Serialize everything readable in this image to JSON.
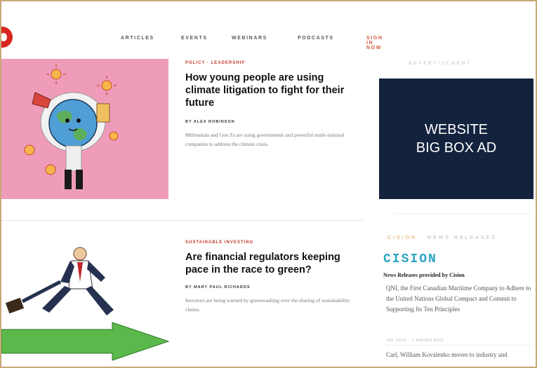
{
  "nav": {
    "items": [
      "ARTICLES",
      "EVENTS",
      "WEBINARS",
      "PODCASTS",
      "SIGN IN NOW"
    ]
  },
  "articles": [
    {
      "kicker": "POLICY · LEADERSHIP",
      "title": "How young people are using climate litigation to fight for their future",
      "byline": "BY ALEX ROBINSON",
      "summary": "Millennials and Gen Zs are suing governments and powerful multi-national companies to address the climate crisis."
    },
    {
      "kicker": "SUSTAINABLE INVESTING",
      "title": "Are financial regulators keeping pace in the race to green?",
      "byline": "BY MARY PAUL RICHARDS",
      "summary": "Investors are being warned by greenwashing over the sharing of sustainability claims."
    }
  ],
  "sidebar": {
    "advertisement_label": "ADVERTISEMENT",
    "ad": {
      "line1": "WEBSITE",
      "line2": "BIG BOX AD"
    },
    "newswire": {
      "label_prefix": "CISION",
      "label_suffix": "NEWS RELEASES",
      "logo": "CISION",
      "provided_by": "News Releases provided by Cision",
      "release1": "QNI, the First Canadian Maritime Company to Adhere to the United Nations Global Compact and Commit to Supporting Its Ten Principles",
      "release1_date": "JUL 2022 · 7 hours ago",
      "release2": "Carl, William Kovalenko moves to industry and "
    }
  },
  "colors": {
    "ad_background": "#13223d",
    "accent_red": "#d7261e",
    "cision_blue": "#2aa4bf",
    "hero_pink": "#ef9cba"
  }
}
